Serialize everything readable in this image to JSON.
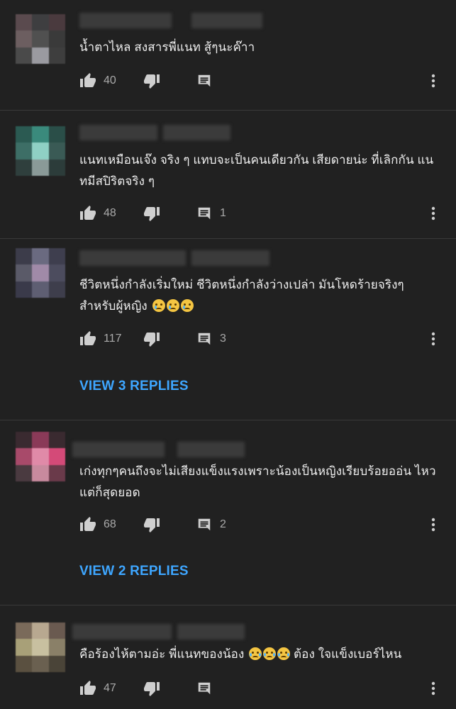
{
  "comments": [
    {
      "text": "น้ำตาไหล สงสารพี่แนท สู้ๆนะค๊าา",
      "likes": "40",
      "replies_count": "",
      "view_replies": "",
      "avatar_colors": [
        "#5a4a4e",
        "#3e3e40",
        "#4a3a3e",
        "#6c5e60",
        "#505050",
        "#3a3a3a",
        "#4a4a4a",
        "#9a9aa0",
        "#3e3e3e"
      ]
    },
    {
      "text": "แนทเหมือนเจ๊ง จริง ๆ  แทบจะเป็นคนเดียวกัน เสียดายน่ะ ที่เลิกกัน แนทมีสปิริตจริง ๆ",
      "likes": "48",
      "replies_count": "1",
      "view_replies": "",
      "avatar_colors": [
        "#2b5a52",
        "#3a8a7c",
        "#2a4e48",
        "#3d6e66",
        "#8fd0c4",
        "#3a5a55",
        "#2f3f3d",
        "#8a9a98",
        "#2c3c3a"
      ]
    },
    {
      "text": "ชีวิตหนึ่งกำลังเริ่มใหม่ ชีวิตหนึ่งกำลังว่างเปล่า มันโหดร้ายจริงๆ สำหรับผู้หญิง",
      "emoji_count": 3,
      "likes": "117",
      "replies_count": "3",
      "view_replies": "VIEW 3 REPLIES",
      "avatar_colors": [
        "#3c3c4a",
        "#6a6a80",
        "#3e3e4e",
        "#5a5a68",
        "#a08aa8",
        "#4c4c5e",
        "#3a3a4a",
        "#5e5e72",
        "#3e3e4c"
      ]
    },
    {
      "text": "เก่งทุกๆคนถึงจะไม่เสียงแข็งแรงเพราะน้องเป็นหญิงเรียบร้อยออ่น ไหวแต่ก็สุดยอด",
      "likes": "68",
      "replies_count": "2",
      "view_replies": "VIEW 2 REPLIES",
      "avatar_colors": [
        "#3a2a30",
        "#8a3a58",
        "#3a2a30",
        "#a84a6a",
        "#e08aa8",
        "#d44a78",
        "#4a3a40",
        "#c88a9e",
        "#6a3a4a"
      ]
    },
    {
      "text": "คือร้องไห้ตามอ่ะ พี่แนทของน้อง",
      "text_after": "ต้อง ใจแข็งเบอร์ไหน",
      "emoji_count": 3,
      "likes": "47",
      "replies_count": "",
      "view_replies": "",
      "avatar_colors": [
        "#7a6a5a",
        "#b8a890",
        "#6a5a50",
        "#a8a078",
        "#c8c0a0",
        "#8a8068",
        "#5a5040",
        "#6a6050",
        "#4a4438"
      ]
    }
  ]
}
